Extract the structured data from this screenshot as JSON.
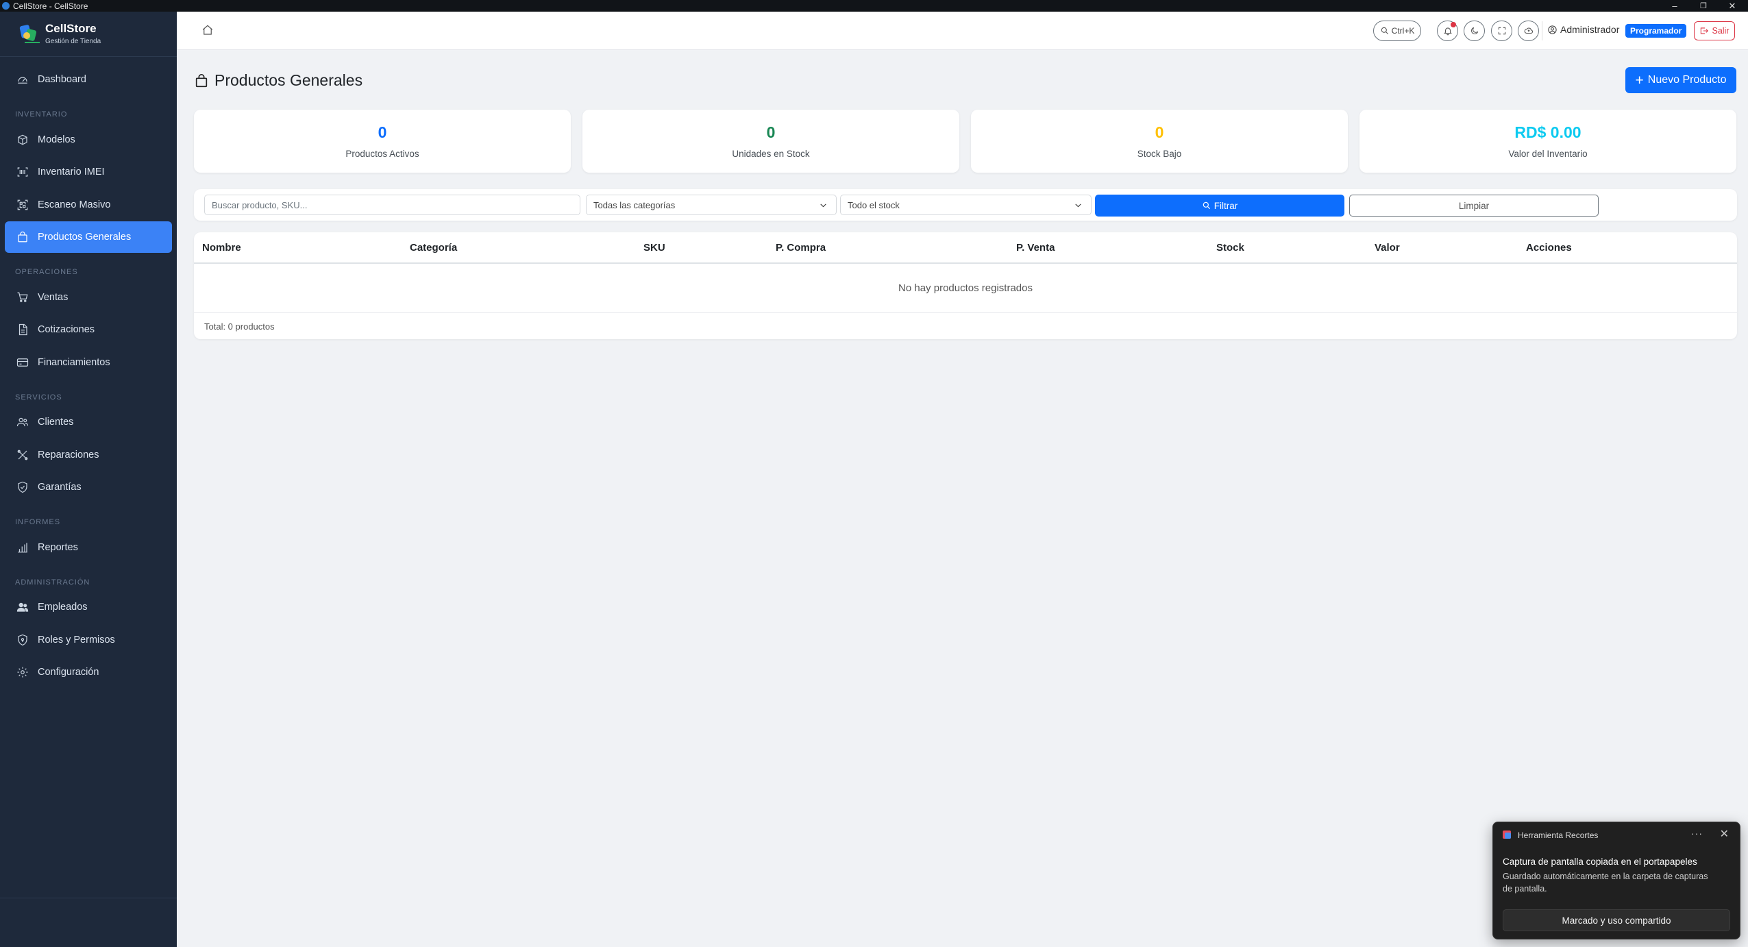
{
  "window": {
    "title": "CellStore - CellStore"
  },
  "brand": {
    "name": "CellStore",
    "subtitle": "Gestión de Tienda"
  },
  "sidebar": {
    "dashboard": "Dashboard",
    "sections": {
      "inventario": "INVENTARIO",
      "operaciones": "OPERACIONES",
      "servicios": "SERVICIOS",
      "informes": "INFORMES",
      "administracion": "ADMINISTRACIÓN"
    },
    "items": {
      "modelos": "Modelos",
      "inventario_imei": "Inventario IMEI",
      "escaneo_masivo": "Escaneo Masivo",
      "productos_generales": "Productos Generales",
      "ventas": "Ventas",
      "cotizaciones": "Cotizaciones",
      "financiamientos": "Financiamientos",
      "clientes": "Clientes",
      "reparaciones": "Reparaciones",
      "garantias": "Garantías",
      "reportes": "Reportes",
      "empleados": "Empleados",
      "roles_permisos": "Roles y Permisos",
      "configuracion": "Configuración"
    }
  },
  "header": {
    "search_shortcut": "Ctrl+K",
    "user_name": "Administrador",
    "role_badge": "Programador",
    "logout_label": "Salir"
  },
  "page": {
    "title": "Productos Generales",
    "new_button": "Nuevo Producto"
  },
  "stats": [
    {
      "value": "0",
      "label": "Productos Activos",
      "color": "#0d6efd"
    },
    {
      "value": "0",
      "label": "Unidades en Stock",
      "color": "#198754"
    },
    {
      "value": "0",
      "label": "Stock Bajo",
      "color": "#ffc107"
    },
    {
      "value": "RD$ 0.00",
      "label": "Valor del Inventario",
      "color": "#0dcaf0"
    }
  ],
  "filters": {
    "search_placeholder": "Buscar producto, SKU...",
    "category_selected": "Todas las categorías",
    "stock_selected": "Todo el stock",
    "filter_button": "Filtrar",
    "clear_button": "Limpiar"
  },
  "table": {
    "columns": [
      "Nombre",
      "Categoría",
      "SKU",
      "P. Compra",
      "P. Venta",
      "Stock",
      "Valor",
      "Acciones"
    ],
    "empty_message": "No hay productos registrados",
    "total_label": "Total: 0 productos"
  },
  "toast": {
    "app_name": "Herramienta Recortes",
    "title": "Captura de pantalla copiada en el portapapeles",
    "body": "Guardado automáticamente en la carpeta de capturas de pantalla.",
    "action_label": "Marcado y uso compartido"
  }
}
